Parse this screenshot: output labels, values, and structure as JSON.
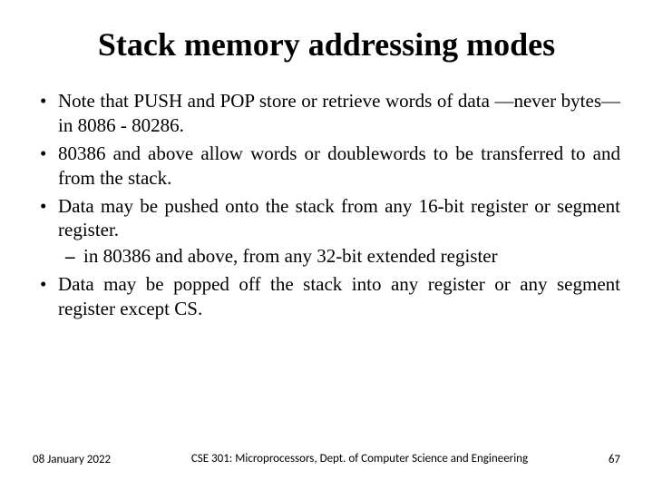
{
  "title": "Stack memory addressing modes",
  "bullets": [
    {
      "text": "Note that PUSH and POP store or retrieve words of data —never bytes—in 8086 - 80286."
    },
    {
      "text": "80386 and above allow words or doublewords to be transferred to and from the stack."
    },
    {
      "text": "Data may be pushed onto the stack from any 16-bit register or segment register.",
      "sub": [
        "in 80386 and above, from any 32-bit extended register"
      ]
    },
    {
      "text": "Data may be popped off the stack into any register or any segment register except CS."
    }
  ],
  "footer": {
    "date": "08 January 2022",
    "course": "CSE 301: Microprocessors, Dept. of Computer Science and Engineering",
    "page": "67"
  }
}
